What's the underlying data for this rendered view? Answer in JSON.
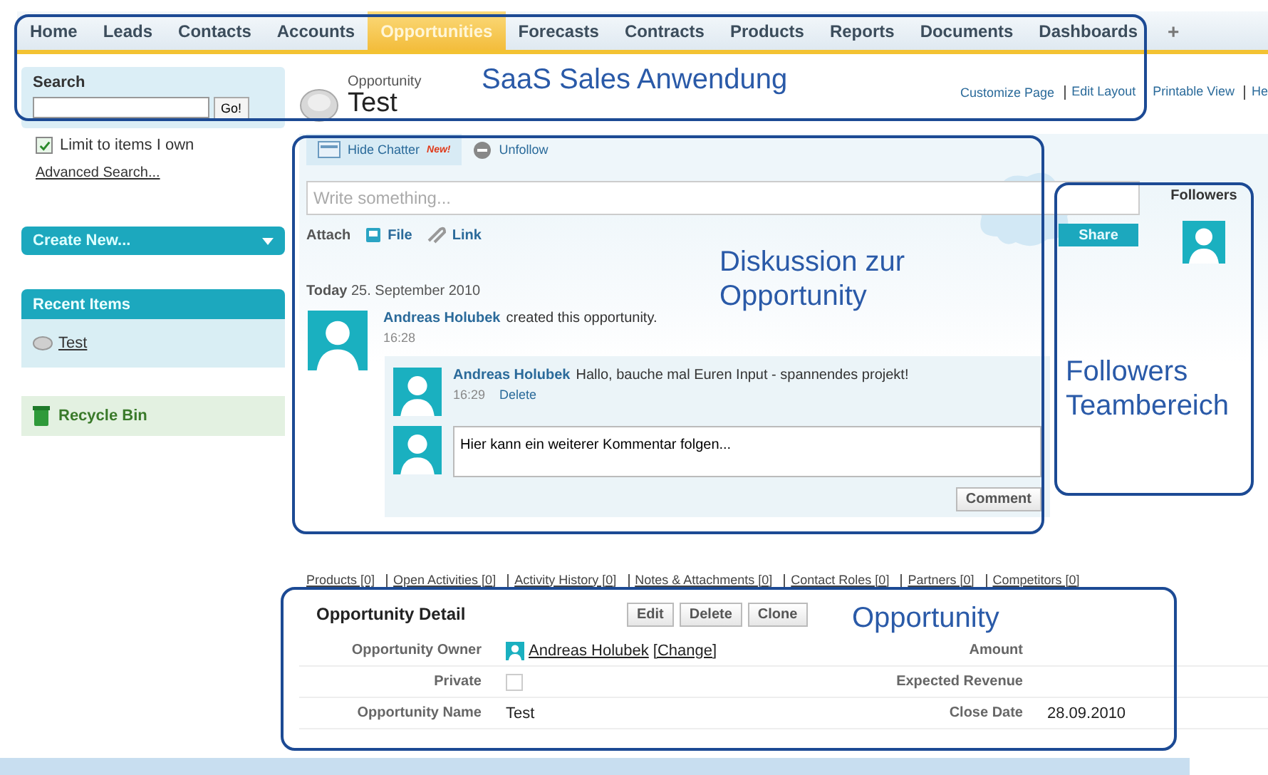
{
  "nav": {
    "tabs": [
      {
        "label": "Home",
        "selected": false
      },
      {
        "label": "Leads",
        "selected": false
      },
      {
        "label": "Contacts",
        "selected": false
      },
      {
        "label": "Accounts",
        "selected": false
      },
      {
        "label": "Opportunities",
        "selected": true
      },
      {
        "label": "Forecasts",
        "selected": false
      },
      {
        "label": "Contracts",
        "selected": false
      },
      {
        "label": "Products",
        "selected": false
      },
      {
        "label": "Reports",
        "selected": false
      },
      {
        "label": "Documents",
        "selected": false
      },
      {
        "label": "Dashboards",
        "selected": false
      }
    ],
    "plus": "+"
  },
  "sidebar": {
    "search": {
      "title": "Search",
      "button": "Go!"
    },
    "limit": {
      "label": "Limit to items I own",
      "checked": true
    },
    "advanced_search": "Advanced Search...",
    "create_new": "Create New...",
    "recent_items": {
      "title": "Recent Items",
      "items": [
        "Test"
      ]
    },
    "recycle_bin": "Recycle Bin"
  },
  "header": {
    "type_label": "Opportunity",
    "title": "Test",
    "links": [
      "Customize Page",
      "Edit Layout",
      "Printable View",
      "He"
    ]
  },
  "chatter": {
    "tabs": [
      {
        "label": "Hide Chatter",
        "kind": "chatter"
      },
      {
        "label": "Unfollow",
        "kind": "unfollow"
      }
    ],
    "new_badge": "New!",
    "composer": {
      "placeholder": "Write something..."
    },
    "attach": "Attach",
    "attach_options": [
      {
        "label": "File",
        "kind": "file"
      },
      {
        "label": "Link",
        "kind": "link"
      }
    ],
    "share": "Share",
    "date": "**Today** 25. September 2010",
    "post": {
      "author": "Andreas Holubek",
      "text": "created this opportunity.",
      "time": "16:28"
    },
    "reply": {
      "author": "Andreas Holubek",
      "text": "Hallo, bauche mal Euren Input - spannendes projekt!",
      "time": "16:29",
      "action": "Delete"
    },
    "comment": {
      "value": "Hier kann ein weiterer Kommentar folgen...",
      "button": "Comment"
    }
  },
  "followers": {
    "title": "Followers"
  },
  "related_links": [
    "Products [0]",
    "Open Activities [0]",
    "Activity History [0]",
    "Notes & Attachments [0]",
    "Contact Roles [0]",
    "Partners [0]",
    "Competitors [0]"
  ],
  "detail": {
    "title": "Opportunity Detail",
    "buttons": [
      "Edit",
      "Delete",
      "Clone"
    ],
    "rows": [
      {
        "label": "Opportunity Owner",
        "kind": "owner",
        "value": "Andreas Holubek",
        "action": "[Change]",
        "right_label": "Amount",
        "right_value": ""
      },
      {
        "label": "Private",
        "kind": "checkbox",
        "checked": false,
        "right_label": "Expected Revenue",
        "right_value": ""
      },
      {
        "label": "Opportunity Name",
        "kind": "text",
        "value": "Test",
        "right_label": "Close Date",
        "right_value": "28.09.2010"
      }
    ]
  },
  "annotations": [
    "SaaS Sales Anwendung",
    "Diskussion zur Opportunity",
    "Followers Teambereich",
    "Opportunity"
  ]
}
